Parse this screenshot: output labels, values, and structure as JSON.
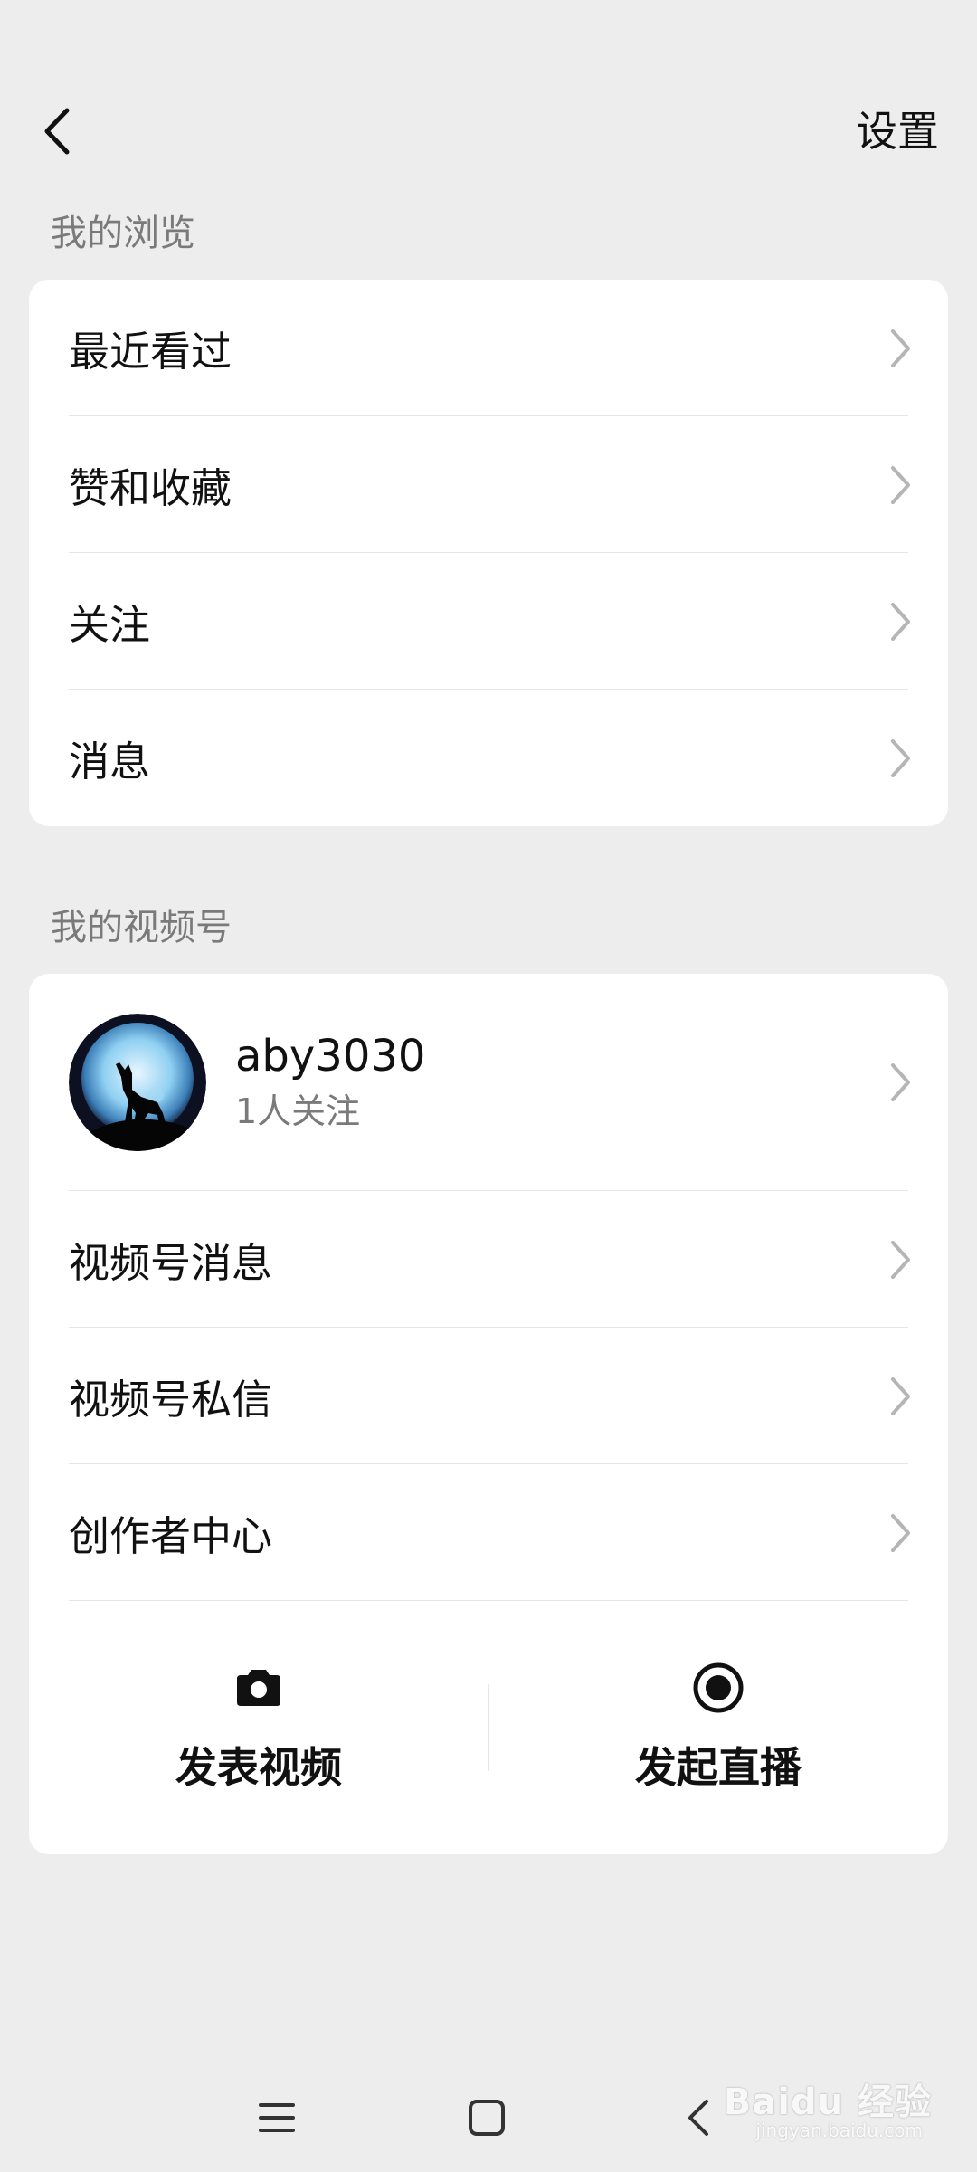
{
  "header": {
    "settings_label": "设置"
  },
  "browse_section": {
    "title": "我的浏览",
    "items": [
      {
        "label": "最近看过"
      },
      {
        "label": "赞和收藏"
      },
      {
        "label": "关注"
      },
      {
        "label": "消息"
      }
    ]
  },
  "channel_section": {
    "title": "我的视频号",
    "profile": {
      "name": "aby3030",
      "followers": "1人关注"
    },
    "items": [
      {
        "label": "视频号消息"
      },
      {
        "label": "视频号私信"
      },
      {
        "label": "创作者中心"
      }
    ],
    "actions": [
      {
        "label": "发表视频",
        "icon": "camera-icon"
      },
      {
        "label": "发起直播",
        "icon": "live-record-icon"
      }
    ]
  },
  "watermark": {
    "brand": "Baidu 经验",
    "url": "jingyan.baidu.com"
  },
  "colors": {
    "background": "#ededed",
    "card": "#ffffff",
    "secondary_text": "#7a7a7a"
  }
}
